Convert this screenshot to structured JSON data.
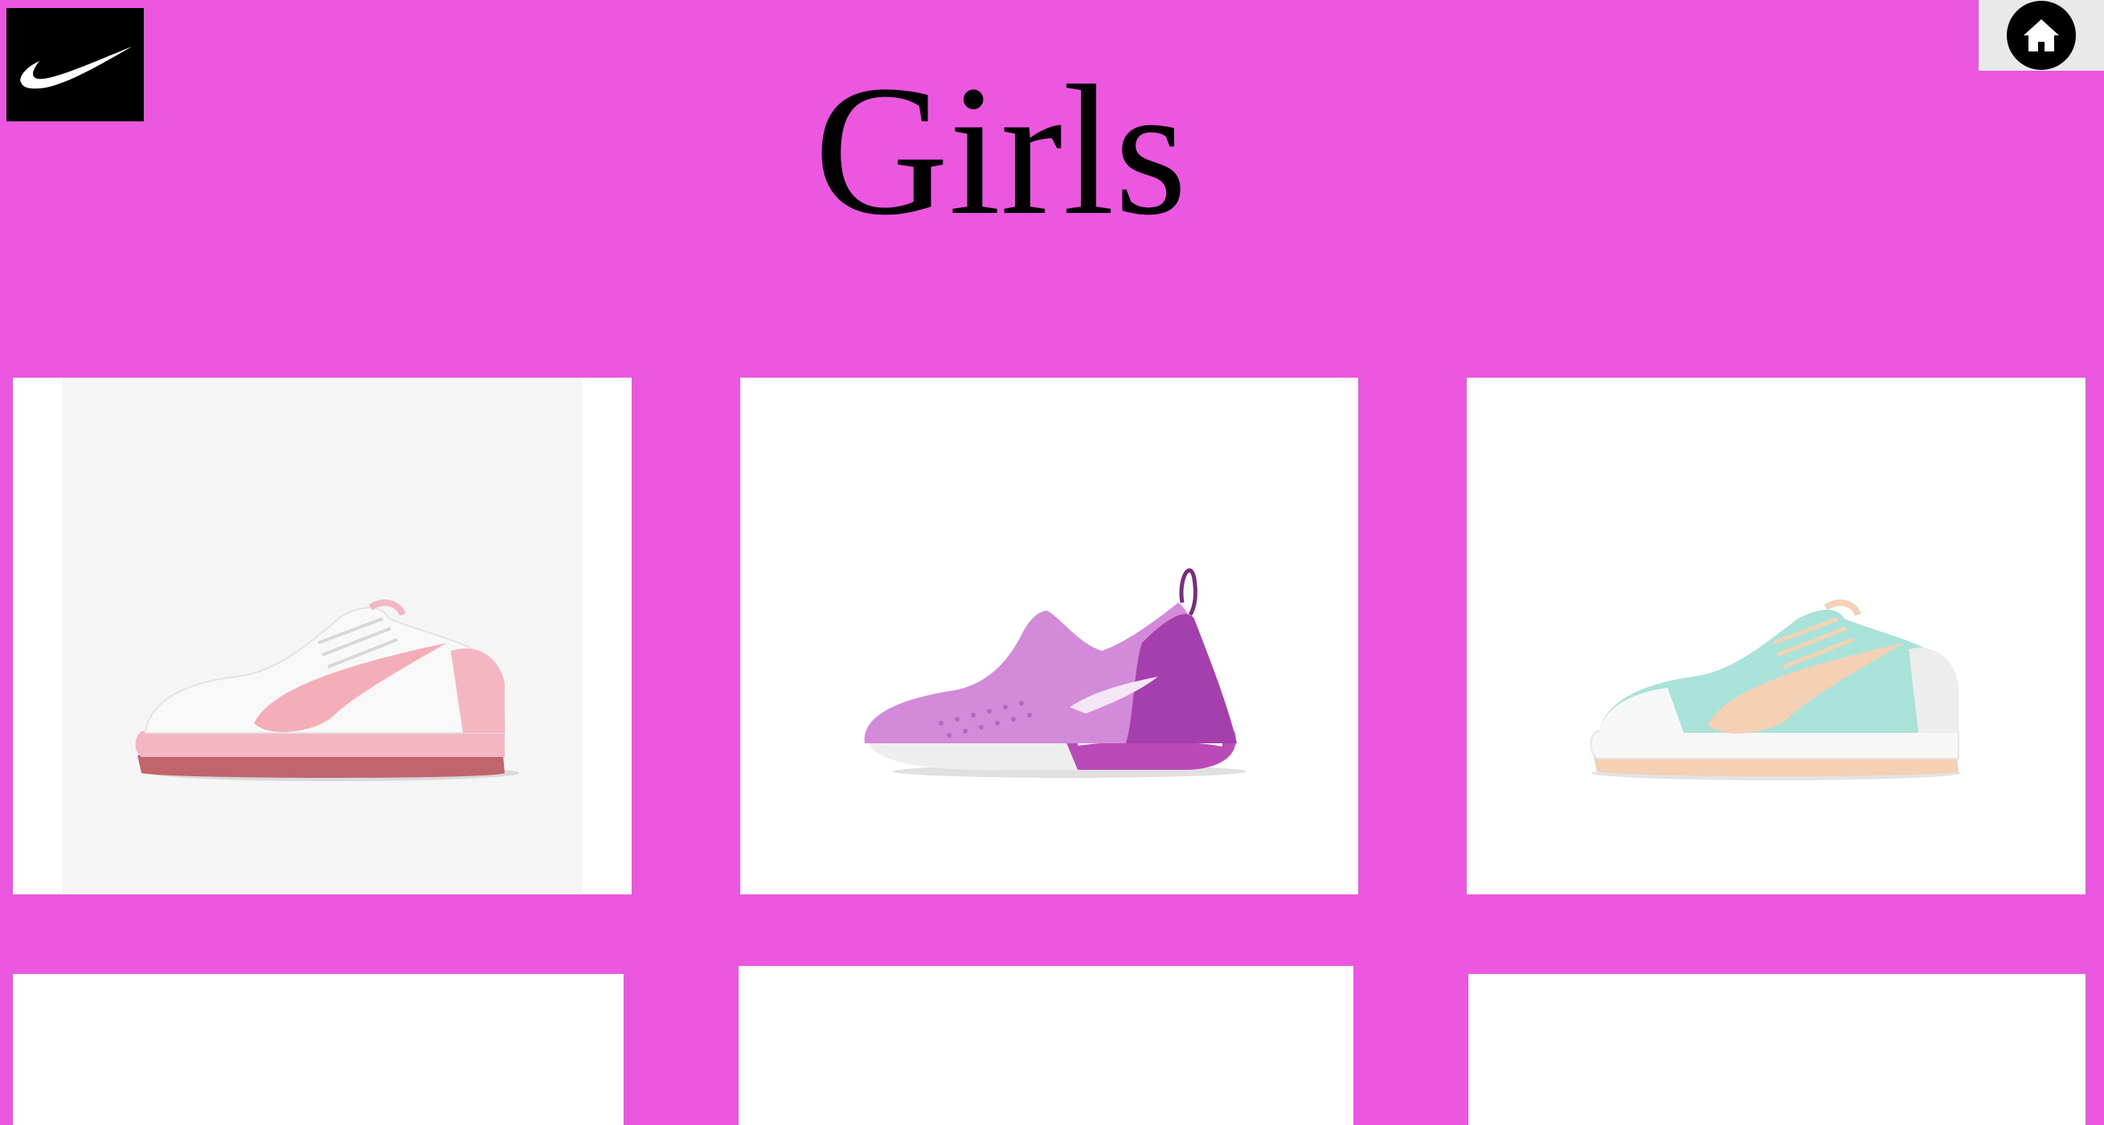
{
  "header": {
    "logo_icon": "nike-swoosh-icon",
    "home_icon": "home-icon",
    "title": "Girls"
  },
  "colors": {
    "background": "#EB57DF",
    "card_background": "#FFFFFF",
    "title_text": "#000000"
  },
  "products": [
    {
      "name": "shoe-white-pink",
      "colors": [
        "#FFFFFF",
        "#F4B6C0",
        "#C0656B"
      ]
    },
    {
      "name": "shoe-purple",
      "colors": [
        "#D38AD9",
        "#A53FAE",
        "#F0F0F0"
      ]
    },
    {
      "name": "shoe-mint-peach",
      "colors": [
        "#A9E2D9",
        "#F4D1B4",
        "#FFFFFF"
      ]
    },
    {
      "name": "product-card-4",
      "colors": [
        "#FFFFFF"
      ]
    },
    {
      "name": "product-card-5",
      "colors": [
        "#FFFFFF"
      ]
    },
    {
      "name": "product-card-6",
      "colors": [
        "#FFFFFF"
      ]
    }
  ]
}
